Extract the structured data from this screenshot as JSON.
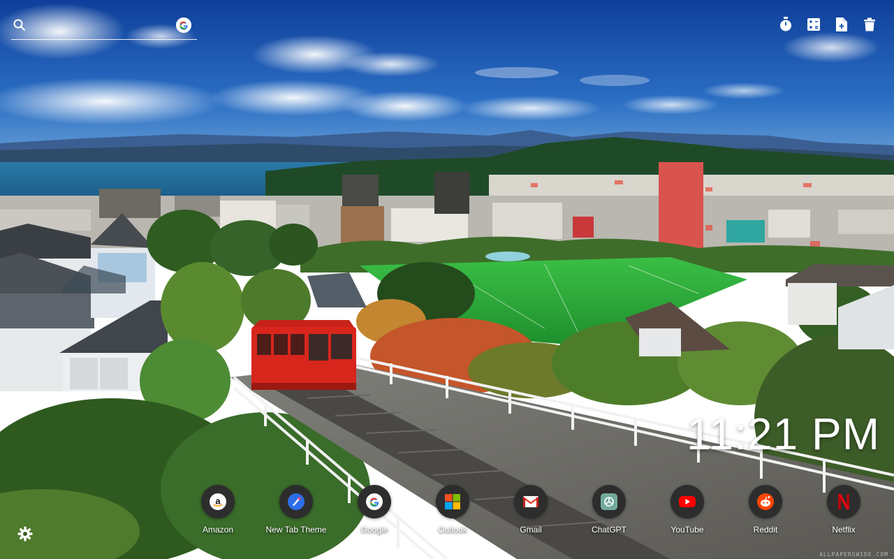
{
  "search": {
    "placeholder": "",
    "icon": "search-icon",
    "engine_button": "google-icon"
  },
  "toolbar": {
    "items": [
      {
        "name": "timer-icon"
      },
      {
        "name": "calculator-icon"
      },
      {
        "name": "new-file-icon"
      },
      {
        "name": "trash-icon"
      }
    ]
  },
  "clock": {
    "time": "11:21 PM"
  },
  "shortcuts": [
    {
      "label": "Amazon",
      "icon": "amazon-icon"
    },
    {
      "label": "New Tab Theme",
      "icon": "new-tab-theme-icon"
    },
    {
      "label": "Google",
      "icon": "google-icon"
    },
    {
      "label": "Outlook",
      "icon": "microsoft-icon"
    },
    {
      "label": "Gmail",
      "icon": "gmail-icon"
    },
    {
      "label": "ChatGPT",
      "icon": "chatgpt-icon"
    },
    {
      "label": "YouTube",
      "icon": "youtube-icon"
    },
    {
      "label": "Reddit",
      "icon": "reddit-icon"
    },
    {
      "label": "Netflix",
      "icon": "netflix-icon"
    }
  ],
  "settings": {
    "icon": "gear-icon"
  },
  "watermark": "ALLPAPERSWIDE.COM",
  "colors": {
    "sky": "#1e5fb4",
    "water": "#1f5f8a",
    "grass": "#2fa83a",
    "cable_car": "#d8261d"
  }
}
